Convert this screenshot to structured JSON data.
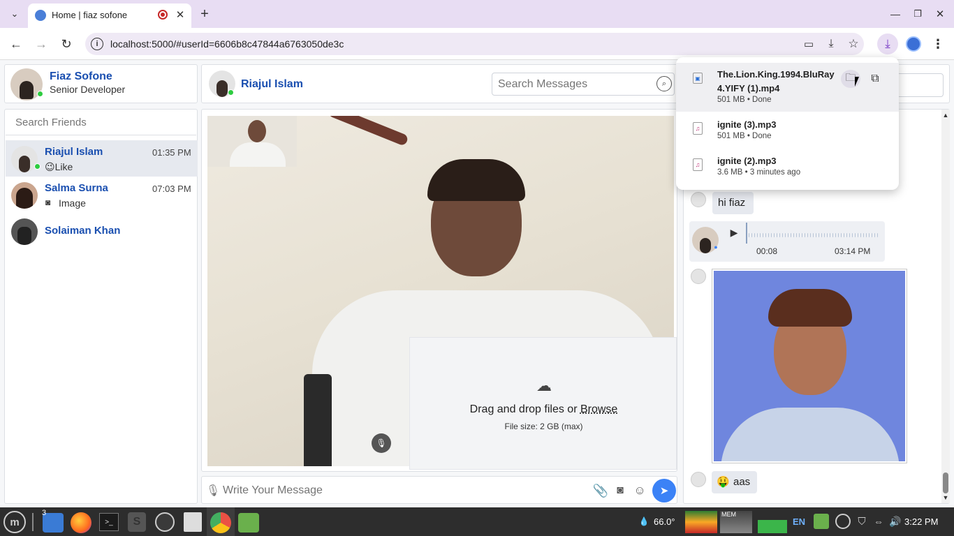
{
  "browser": {
    "tab_title": "Home | fiaz sofone",
    "url": "localhost:5000/#userId=6606b8c47844a6763050de3c"
  },
  "profile": {
    "name": "Fiaz Sofone",
    "title": "Senior Developer"
  },
  "search_friends_placeholder": "Search Friends",
  "friends": [
    {
      "name": "Riajul Islam",
      "time": "01:35 PM",
      "preview": "😉Like"
    },
    {
      "name": "Salma Surna",
      "time": "07:03 PM",
      "preview": "Image"
    },
    {
      "name": "Solaiman Khan",
      "time": "",
      "preview": ""
    }
  ],
  "chat": {
    "contact_name": "Riajul Islam",
    "search_placeholder": "Search Messages",
    "message_placeholder": "Write Your Message"
  },
  "upload": {
    "text_prefix": "Drag and drop files or ",
    "browse": "Browse",
    "size_note": "File size: 2 GB (max)"
  },
  "downloads": [
    {
      "name": "The.Lion.King.1994.BluRay 4.YIFY (1).mp4",
      "line1": "The.Lion.King.1994.BluRay",
      "line2": "4.YIFY (1).mp4",
      "meta": "501 MB • Done"
    },
    {
      "name": "ignite (3).mp3",
      "meta": "501 MB • Done"
    },
    {
      "name": "ignite (2).mp3",
      "meta": "3.6 MB • 3 minutes ago"
    }
  ],
  "messages": {
    "text1": "hi fiaz",
    "audio_elapsed": "00:08",
    "audio_time": "03:14 PM",
    "text2_emoji": "🤑",
    "text2": "aas"
  },
  "taskbar": {
    "badge": "3",
    "temp": "66.0°",
    "lang": "EN",
    "clock": "3:22 PM",
    "mem_label": "MEM"
  },
  "colors": {
    "accent": "#1a4fb0",
    "send": "#3b82f6",
    "online": "#2ecc40",
    "tab_bg": "#e8ddf3"
  }
}
